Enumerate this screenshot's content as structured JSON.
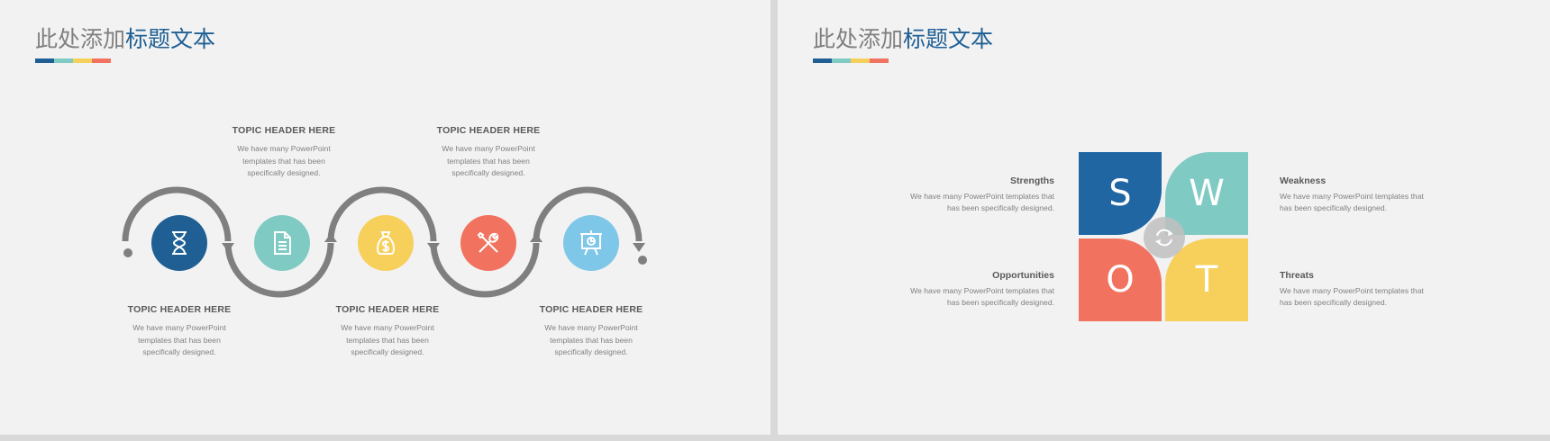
{
  "left_slide": {
    "title_grey": "此处添加",
    "title_blue": "标题文本",
    "underline_colors": [
      "#1f5f94",
      "#7fcbc3",
      "#f7cf5b",
      "#f1735f"
    ],
    "topics": [
      {
        "header": "TOPIC HEADER HERE",
        "body": [
          "We have many PowerPoint",
          "templates that has been",
          "specifically designed."
        ]
      },
      {
        "header": "TOPIC HEADER HERE",
        "body": [
          "We have many PowerPoint",
          "templates that has been",
          "specifically designed."
        ]
      },
      {
        "header": "TOPIC HEADER HERE",
        "body": [
          "We have many PowerPoint",
          "templates that has been",
          "specifically designed."
        ]
      },
      {
        "header": "TOPIC HEADER HERE",
        "body": [
          "We have many PowerPoint",
          "templates that has been",
          "specifically designed."
        ]
      },
      {
        "header": "TOPIC HEADER HERE",
        "body": [
          "We have many PowerPoint",
          "templates that has been",
          "specifically designed."
        ]
      }
    ],
    "steps": [
      {
        "icon": "hourglass-icon",
        "color": "#1f5f94"
      },
      {
        "icon": "document-icon",
        "color": "#7fcbc3"
      },
      {
        "icon": "money-bag-icon",
        "color": "#f7cf5b"
      },
      {
        "icon": "tools-icon",
        "color": "#f1735f"
      },
      {
        "icon": "presentation-icon",
        "color": "#7fc7e8"
      }
    ],
    "track_color": "#7f7f7f"
  },
  "right_slide": {
    "title_grey": "此处添加",
    "title_blue": "标题文本",
    "underline_colors": [
      "#1f5f94",
      "#7fcbc3",
      "#f7cf5b",
      "#f1735f"
    ],
    "swot": {
      "s": {
        "letter": "S",
        "color": "#1f66a3",
        "label": "Strengths",
        "body": [
          "We have many PowerPoint templates that",
          "has been specifically designed."
        ]
      },
      "w": {
        "letter": "W",
        "color": "#7fcbc3",
        "label": "Weakness",
        "body": [
          "We have many PowerPoint templates that",
          "has been specifically designed."
        ]
      },
      "o": {
        "letter": "O",
        "color": "#f1735f",
        "label": "Opportunities",
        "body": [
          "We have many PowerPoint templates that",
          "has been specifically designed."
        ]
      },
      "t": {
        "letter": "T",
        "color": "#f7cf5b",
        "label": "Threats",
        "body": [
          "We have many PowerPoint templates that",
          "has been specifically designed."
        ]
      }
    },
    "center_icon": "refresh-icon"
  }
}
